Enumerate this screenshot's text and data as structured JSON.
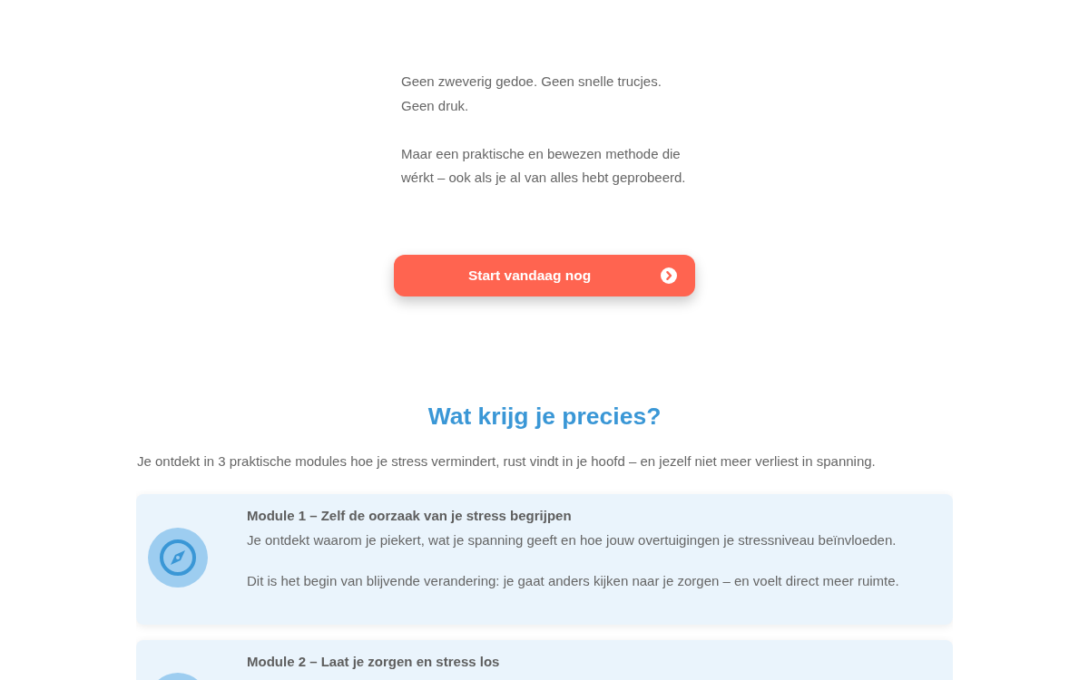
{
  "intro": {
    "paragraphs": [
      "Geen zweverig gedoe. Geen snelle trucjes. Geen druk.",
      "Maar een praktische en bewezen methode die wérkt – ook als je al van alles hebt geprobeerd."
    ]
  },
  "cta_button": {
    "label": "Start vandaag nog"
  },
  "section": {
    "title": "Wat krijg je precies?",
    "intro": "Je ontdekt in 3 praktische modules hoe je stress vermindert, rust vindt in je hoofd – en jezelf niet meer verliest in spanning.",
    "modules": [
      {
        "title": "Module 1 – Zelf de oorzaak van je stress begrijpen",
        "paragraphs": [
          "Je ontdekt waarom je piekert, wat je spanning geeft en hoe jouw overtuigingen je stressniveau beïnvloeden.",
          "Dit is het begin van blijvende verandering: je gaat anders kijken naar je zorgen – en voelt direct meer ruimte."
        ]
      },
      {
        "title": "Module 2 – Laat je zorgen en stress los"
      }
    ]
  }
}
